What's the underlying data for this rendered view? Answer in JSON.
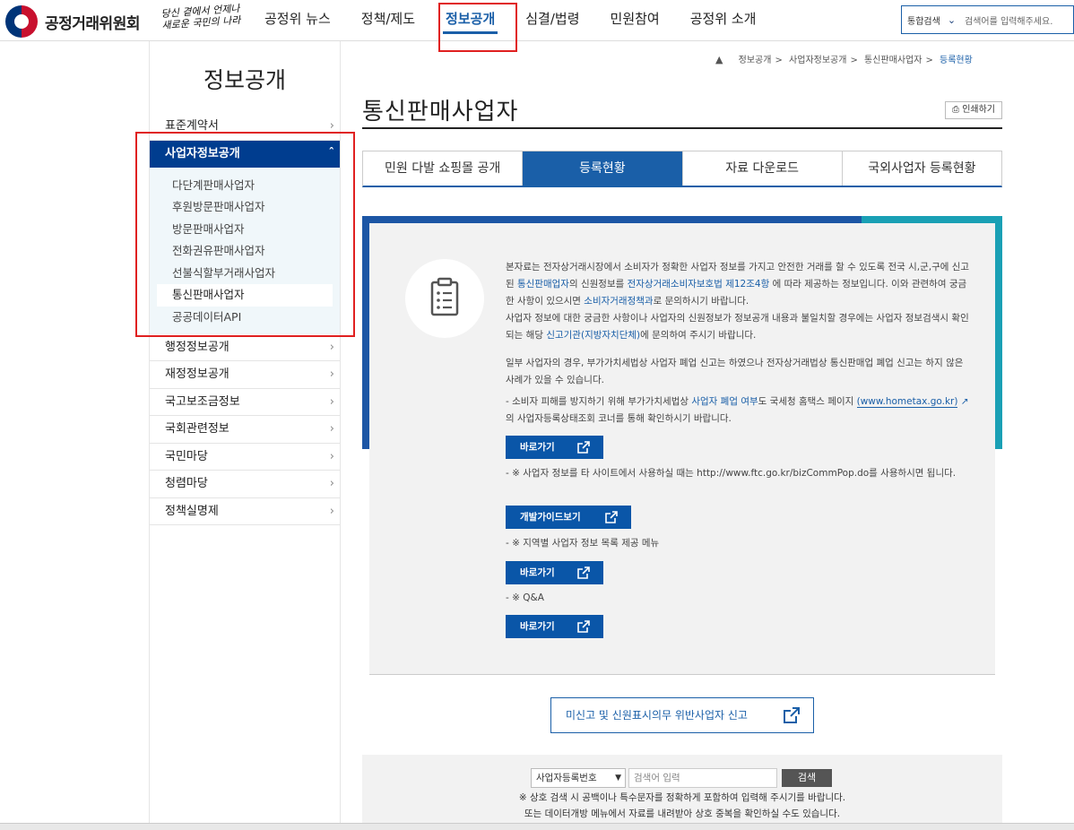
{
  "header": {
    "logo_text": "공정거래위원회",
    "slogan_line1": "당신 곁에서 언제나",
    "slogan_line2": "새로운 국민의 나라",
    "nav": [
      "공정위 뉴스",
      "정책/제도",
      "정보공개",
      "심결/법령",
      "민원참여",
      "공정위 소개"
    ],
    "search_scope": "통합검색",
    "search_placeholder": "검색어를 입력해주세요."
  },
  "sidebar": {
    "title": "정보공개",
    "items": [
      {
        "label": "표준계약서"
      },
      {
        "label": "사업자정보공개"
      },
      {
        "label": "행정정보공개"
      },
      {
        "label": "재정정보공개"
      },
      {
        "label": "국고보조금정보"
      },
      {
        "label": "국회관련정보"
      },
      {
        "label": "국민마당"
      },
      {
        "label": "청렴마당"
      },
      {
        "label": "정책실명제"
      }
    ],
    "sub_items": [
      "다단계판매사업자",
      "후원방문판매사업자",
      "방문판매사업자",
      "전화권유판매사업자",
      "선불식할부거래사업자",
      "통신판매사업자",
      "공공데이터API"
    ]
  },
  "breadcrumb": [
    "정보공개",
    "사업자정보공개",
    "통신판매사업자",
    "등록현황"
  ],
  "page": {
    "title": "통신판매사업자",
    "print_label": "인쇄하기",
    "tabs": [
      "민원 다발 쇼핑몰 공개",
      "등록현황",
      "자료 다운로드",
      "국외사업자 등록현황"
    ]
  },
  "info": {
    "p1a": "본자료는 전자상거래시장에서 소비자가 정확한 사업자 정보를 가지고 안전한 거래를 할 수 있도록 전국 시,군,구에 신고된 ",
    "p1_link1": "통신판매업자",
    "p1b": "의 신원정보를 ",
    "p1_link2": "전자상거래소비자보호법 제12조4항",
    "p1c": " 에 따라 제공하는 정보입니다. 이와 관련하여 궁금한 사항이 있으시면 ",
    "p1_link3": "소비자거래정책과",
    "p1d": "로 문의하시기 바랍니다.",
    "p2a": "사업자 정보에 대한 궁금한 사항이나 사업자의 신원정보가 정보공개 내용과 불일치할 경우에는 사업자 정보검색시 확인되는 해당 ",
    "p2_link": "신고기관(지방자치단체)",
    "p2b": "에 문의하여 주시기 바랍니다.",
    "p3": "일부 사업자의 경우, 부가가치세법상 사업자 폐업 신고는 하였으나 전자상거래법상 통신판매업 폐업 신고는 하지 않은 사례가 있을 수 있습니다.",
    "b1a": "- 소비자 피해를 방지하기 위해 부가가치세법상 ",
    "b1_link": "사업자 폐업 여부",
    "b1b": "도 국세청 홈택스 페이지 ",
    "b1_url": "(www.hometax.go.kr)",
    "b1c": "의 사업자등록상태조회 코너를 통해 확인하시기 바랍니다.",
    "btn1": "바로가기",
    "b2": "- ※ 사업자 정보를 타 사이트에서 사용하실 때는 http://www.ftc.go.kr/bizCommPop.do를 사용하시면 됩니다.",
    "btn2": "개발가이드보기",
    "b3": "- ※ 지역별 사업자 정보 목록 제공 메뉴",
    "btn3": "바로가기",
    "b4": "- ※ Q&A",
    "btn4": "바로가기"
  },
  "report_button": "미신고 및 신원표시의무 위반사업자 신고",
  "search": {
    "select_value": "사업자등록번호",
    "input_placeholder": "검색어 입력",
    "button": "검색",
    "note1": "※ 상호 검색 시 공백이나 특수문자를 정확하게 포함하여 입력해 주시기를 바랍니다.",
    "note2": "또는 데이터개방 메뉴에서 자료를 내려받아 상호 중복을 확인하실 수도 있습니다."
  },
  "colors": {
    "primary": "#1a5fa8",
    "sidebar_active": "#003d8f",
    "banner_blue": "#1c56a5",
    "banner_teal": "#1aa0b5",
    "highlight": "#e02020"
  }
}
